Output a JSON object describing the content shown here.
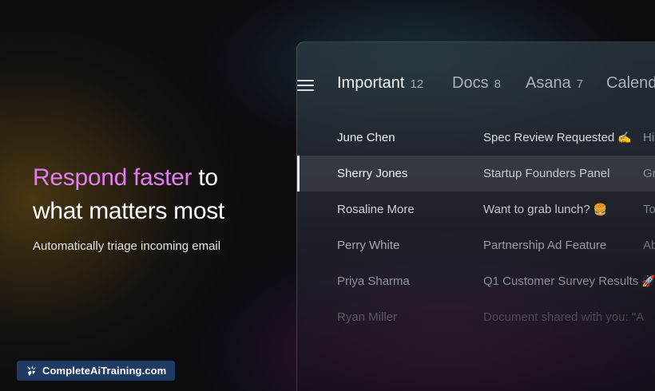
{
  "hero": {
    "headline_accent": "Respond faster",
    "headline_rest_1": " to",
    "headline_line_2": "what matters most",
    "subline": "Automatically triage incoming email"
  },
  "app": {
    "menu_icon": "hamburger-menu-icon",
    "tabs": [
      {
        "label": "Important",
        "count": "12",
        "active": true
      },
      {
        "label": "Docs",
        "count": "8",
        "active": false
      },
      {
        "label": "Asana",
        "count": "7",
        "active": false
      },
      {
        "label": "Calend",
        "count": "",
        "active": false
      }
    ],
    "emails": [
      {
        "sender": "June Chen",
        "subject": "Spec Review Requested",
        "emoji": "✍️",
        "preview": "Hi"
      },
      {
        "sender": "Sherry Jones",
        "subject": "Startup Founders Panel",
        "emoji": "",
        "preview": "Great",
        "selected": true
      },
      {
        "sender": "Rosaline More",
        "subject": "Want to grab lunch?",
        "emoji": "🍔",
        "preview": "Tomo"
      },
      {
        "sender": "Perry White",
        "subject": "Partnership Ad Feature",
        "emoji": "",
        "preview": "Abso"
      },
      {
        "sender": "Priya Sharma",
        "subject": "Q1 Customer Survey Results",
        "emoji": "🚀",
        "preview": ""
      },
      {
        "sender": "Ryan Miller",
        "subject": "Document shared with you: \"A",
        "emoji": "",
        "preview": ""
      }
    ]
  },
  "brand": {
    "logo_icon": "sparkle-logo-icon",
    "label": "CompleteAiTraining.com",
    "color": "#1f3a63"
  },
  "colors": {
    "accent": "#e27cf0"
  }
}
